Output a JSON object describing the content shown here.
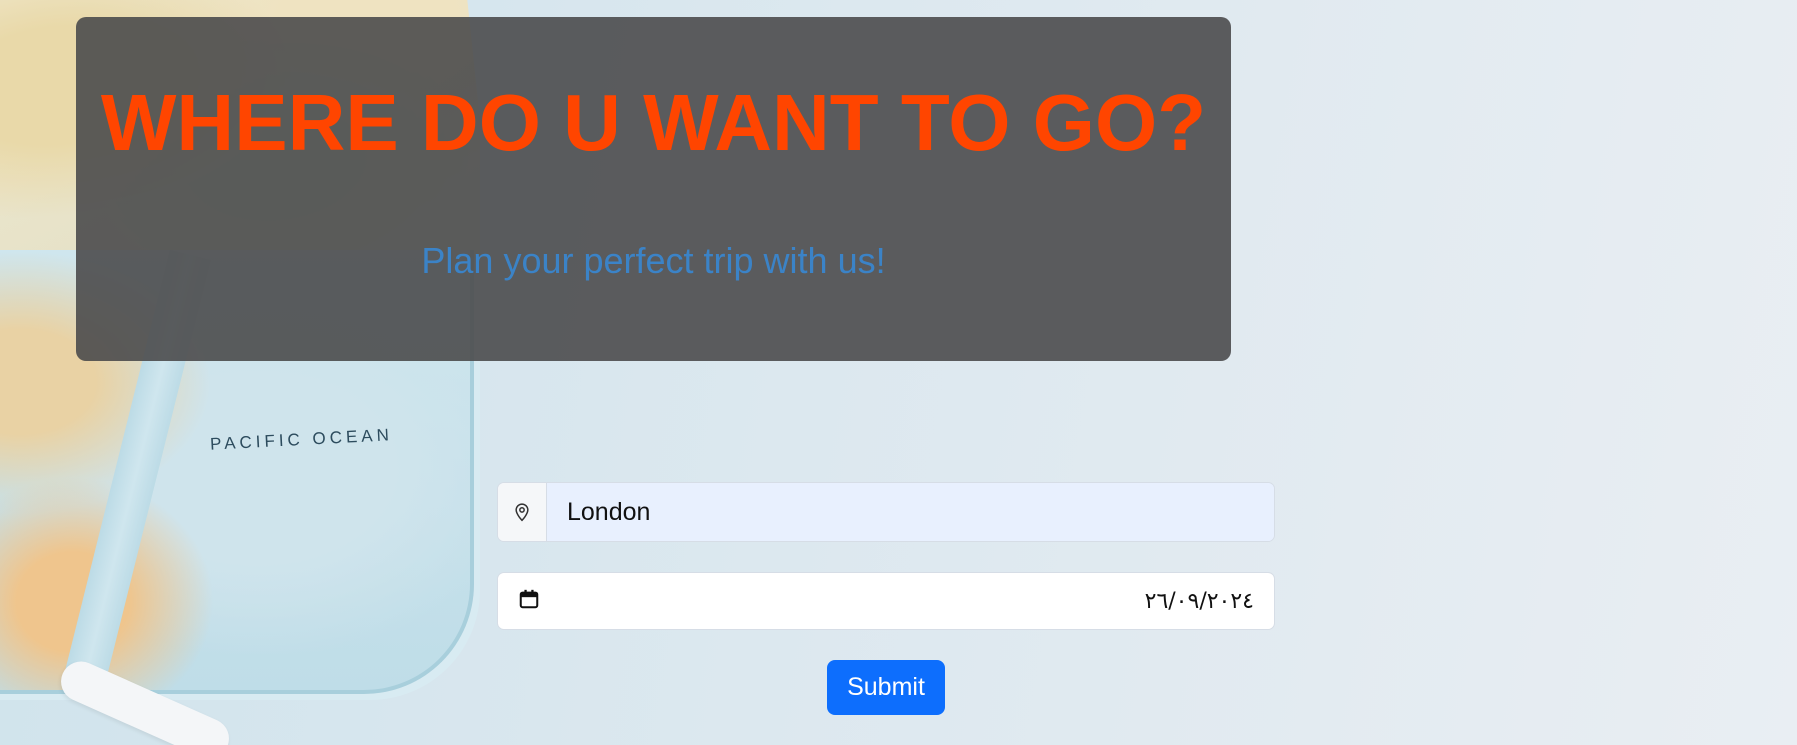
{
  "header": {
    "title": "WHERE DO U WANT TO GO?",
    "subtitle": "Plan your perfect trip with us!"
  },
  "background": {
    "map_label": "PACIFIC OCEAN"
  },
  "form": {
    "location": {
      "icon": "location-pin-icon",
      "value": "London"
    },
    "date": {
      "icon": "calendar-icon",
      "value": "٢٦/٠٩/٢٠٢٤"
    },
    "submit_label": "Submit"
  },
  "colors": {
    "title": "#ff4500",
    "subtitle": "#3b83c7",
    "panel": "#4b4b4d",
    "submit": "#0d6efd"
  }
}
